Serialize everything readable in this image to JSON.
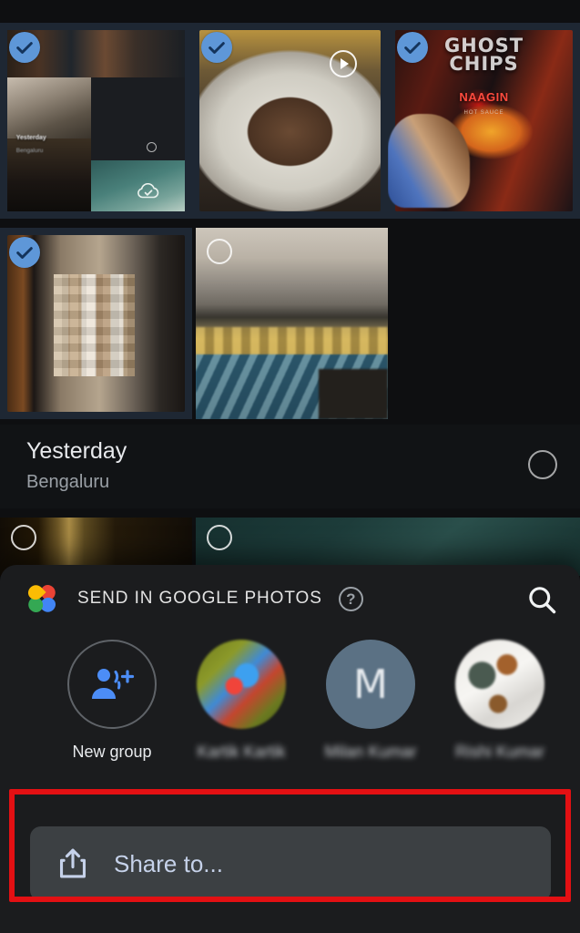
{
  "app": {
    "name": "Google Photos",
    "screen": "photo picker with share sheet"
  },
  "grid": {
    "rows": [
      {
        "tiles": [
          {
            "name": "collage-screenshot-thumbnail",
            "kind": "collage",
            "selected": true,
            "selection_icon": "check-icon",
            "inner_label": "Yesterday",
            "inner_sublabel": "Bengaluru",
            "badge": "cloud-backup-done-icon"
          },
          {
            "name": "food-plate-photo",
            "kind": "food",
            "selected": true,
            "selection_icon": "check-icon",
            "badge": "motion-photo-play-icon"
          },
          {
            "name": "snack-packet-photo",
            "kind": "chips",
            "selected": true,
            "selection_icon": "check-icon",
            "packet_title": "GHOST",
            "packet_title2": "CHIPS",
            "packet_brand": "NAAGIN",
            "packet_tagline": "HOT SAUCE"
          }
        ]
      },
      {
        "tiles": [
          {
            "name": "blurred-room-photo",
            "kind": "blur-room",
            "selected": true,
            "selection_icon": "check-icon"
          },
          {
            "name": "banquet-hall-photo",
            "kind": "hall",
            "selected": false,
            "selection_icon": "circle-outline-icon"
          }
        ]
      }
    ],
    "partial_row": {
      "tiles": [
        {
          "name": "dark-gold-photo",
          "kind": "dark-gold",
          "selected": false,
          "selection_icon": "circle-outline-icon"
        },
        {
          "name": "dark-teal-photo",
          "kind": "dark-teal",
          "selected": false,
          "selection_icon": "circle-outline-icon"
        }
      ]
    }
  },
  "date_header": {
    "title": "Yesterday",
    "subtitle": "Bengaluru",
    "select_all_icon": "circle-outline-icon"
  },
  "sheet": {
    "logo": "google-photos-pinwheel-icon",
    "title": "SEND IN GOOGLE PHOTOS",
    "help_icon": "help-question-icon",
    "help_label": "?",
    "search_icon": "search-icon",
    "contacts": [
      {
        "name": "New group",
        "avatar": "person-add-icon",
        "redacted": false
      },
      {
        "name": "Kartik Kartik",
        "avatar": "contact-photo-colorful",
        "redacted": true
      },
      {
        "name": "Milan Kumar",
        "avatar": "contact-initial-avatar",
        "initial": "M",
        "redacted": true
      },
      {
        "name": "Rishi Kumar",
        "avatar": "contact-photo-light",
        "redacted": true
      }
    ],
    "share_button": {
      "label": "Share to...",
      "icon": "share-upload-icon"
    }
  },
  "annotation": {
    "type": "highlight-rectangle",
    "color": "#e31013",
    "target": "Share to... button"
  },
  "colors": {
    "background": "#0d0e10",
    "sheet_background": "#1b1c1e",
    "selected_tile_background": "#1e2733",
    "accent_blue": "#4c8df6",
    "share_text": "#c6d2ea",
    "share_button_background": "#3c4043",
    "secondary_text": "#9aa0a6",
    "primary_text": "#e8eaed",
    "check_badge": "#5e97d8",
    "annotation_red": "#e31013"
  }
}
